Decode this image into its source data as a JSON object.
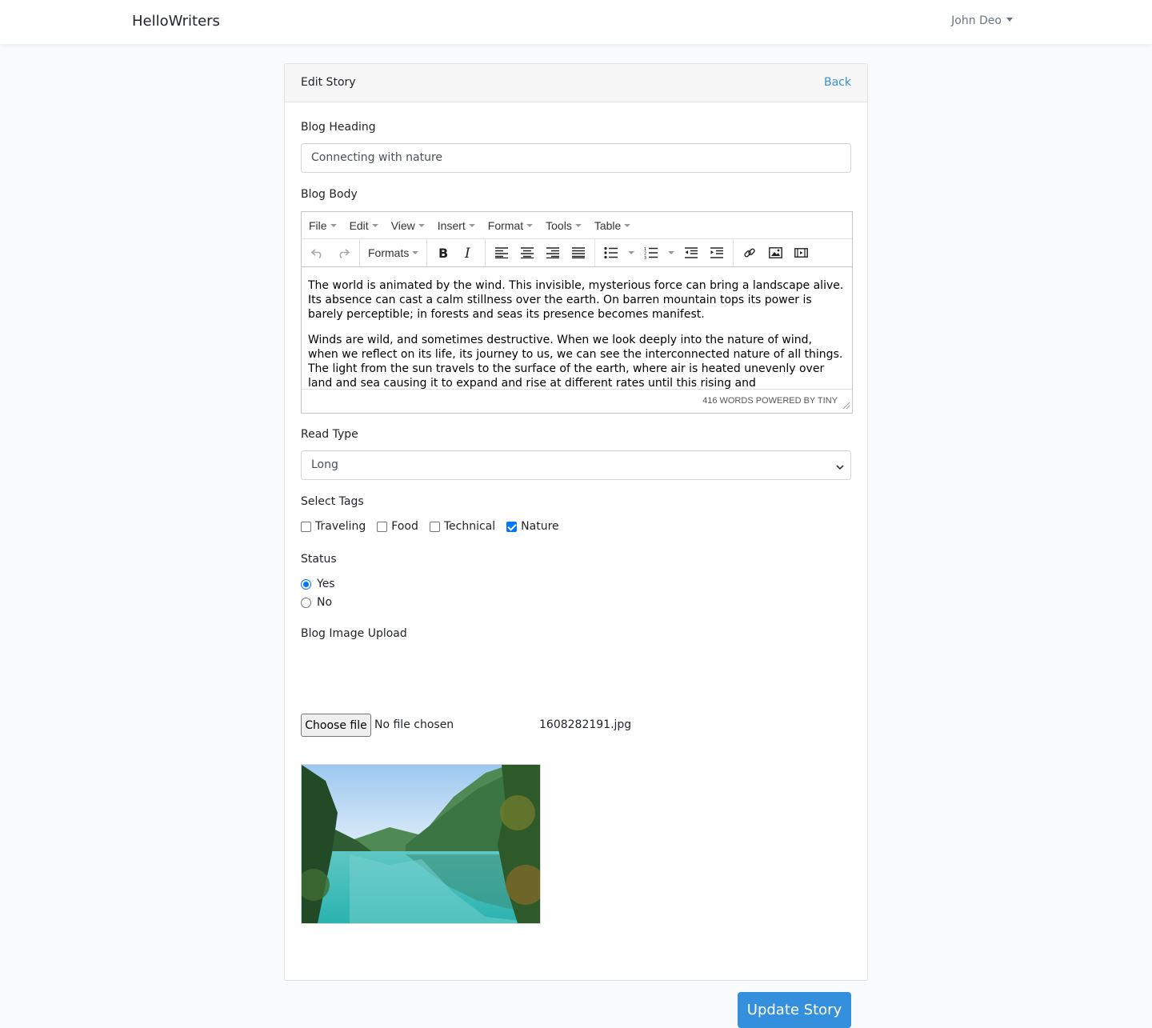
{
  "nav": {
    "brand": "HelloWriters",
    "user": "John Deo"
  },
  "card": {
    "title": "Edit Story",
    "back": "Back"
  },
  "heading": {
    "label": "Blog Heading",
    "value": "Connecting with nature"
  },
  "body": {
    "label": "Blog Body",
    "menu": [
      "File",
      "Edit",
      "View",
      "Insert",
      "Format",
      "Tools",
      "Table"
    ],
    "formats_label": "Formats",
    "paragraphs": [
      "The world is animated by the wind. This invisible, mysterious force can bring a landscape alive. Its absence can cast a calm stillness over the earth. On barren mountain tops its power is barely perceptible; in forests and seas its presence becomes manifest.",
      "Winds are wild, and sometimes destructive. When we look deeply into the nature of wind, when we reflect on its life, its journey to us, we can see the interconnected nature of all things. The light from the sun travels to the surface of the earth, where air is heated unevenly over land and sea causing it to expand and rise at different rates until this rising and"
    ],
    "status": "416 WORDS POWERED BY TINY"
  },
  "read_type": {
    "label": "Read Type",
    "selected": "Long"
  },
  "tags": {
    "label": "Select Tags",
    "items": [
      {
        "label": "Traveling",
        "checked": false
      },
      {
        "label": "Food",
        "checked": false
      },
      {
        "label": "Technical",
        "checked": false
      },
      {
        "label": "Nature",
        "checked": true
      }
    ]
  },
  "status": {
    "label": "Status",
    "options": [
      {
        "label": "Yes",
        "checked": true
      },
      {
        "label": "No",
        "checked": false
      }
    ]
  },
  "upload": {
    "label": "Blog Image Upload",
    "button": "Choose file",
    "status": "No file chosen",
    "current_file": "1608282191.jpg"
  },
  "submit": "Update Story",
  "colors": {
    "primary": "#3490dc",
    "checked": "#0075ff"
  }
}
